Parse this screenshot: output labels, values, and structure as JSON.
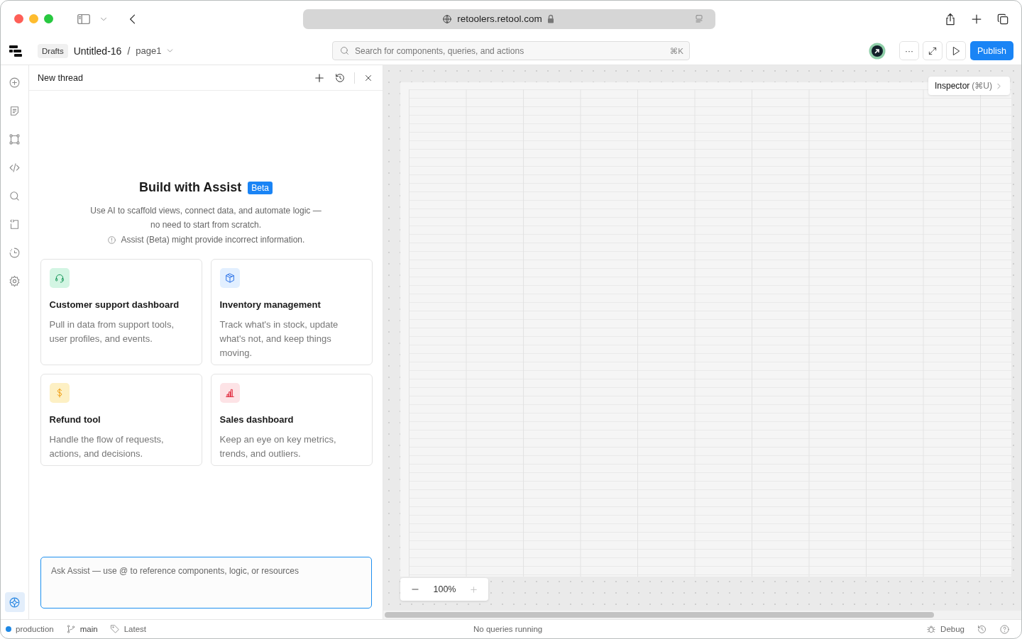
{
  "browser": {
    "url": "retoolers.retool.com",
    "secure": true
  },
  "header": {
    "breadcrumb_root": "Drafts",
    "app_name": "Untitled-16",
    "separator": "/",
    "page": "page1",
    "search": {
      "placeholder": "Search for components, queries, and actions",
      "shortcut": "⌘K"
    },
    "more": "···",
    "publish": "Publish"
  },
  "rail_items": [
    {
      "kind": "add",
      "selected": false
    },
    {
      "kind": "notes",
      "selected": false
    },
    {
      "kind": "graph",
      "selected": false
    },
    {
      "kind": "code",
      "selected": false
    },
    {
      "kind": "search",
      "selected": false
    },
    {
      "kind": "snippet",
      "selected": false
    },
    {
      "kind": "history",
      "selected": false
    },
    {
      "kind": "settings",
      "selected": false
    },
    {
      "kind": "assist",
      "selected": true
    }
  ],
  "assist": {
    "title": "New thread",
    "heading": "Build with Assist",
    "badge": "Beta",
    "description": "Use AI to scaffold views, connect data, and automate logic — no need to start from scratch.",
    "warning": "Assist (Beta) might provide incorrect information.",
    "cards": [
      {
        "kind": "support",
        "title": "Customer support dashboard",
        "text": "Pull in data from support tools, user profiles, and events."
      },
      {
        "kind": "inventory",
        "title": "Inventory management",
        "text": "Track what's in stock, update what's not, and keep things moving."
      },
      {
        "kind": "refund",
        "title": "Refund tool",
        "text": "Handle the flow of requests, actions, and decisions."
      },
      {
        "kind": "sales",
        "title": "Sales dashboard",
        "text": "Keep an eye on key metrics, trends, and outliers."
      }
    ],
    "input": {
      "placeholder": "Ask Assist — use @ to reference components, logic, or resources"
    }
  },
  "canvas": {
    "inspector": "Inspector",
    "inspector_shortcut": "(⌘U)",
    "zoom": "100%"
  },
  "status_bar": {
    "environment": "production",
    "branch": "main",
    "tag": "Latest",
    "queries": "No queries running",
    "debug": "Debug"
  }
}
